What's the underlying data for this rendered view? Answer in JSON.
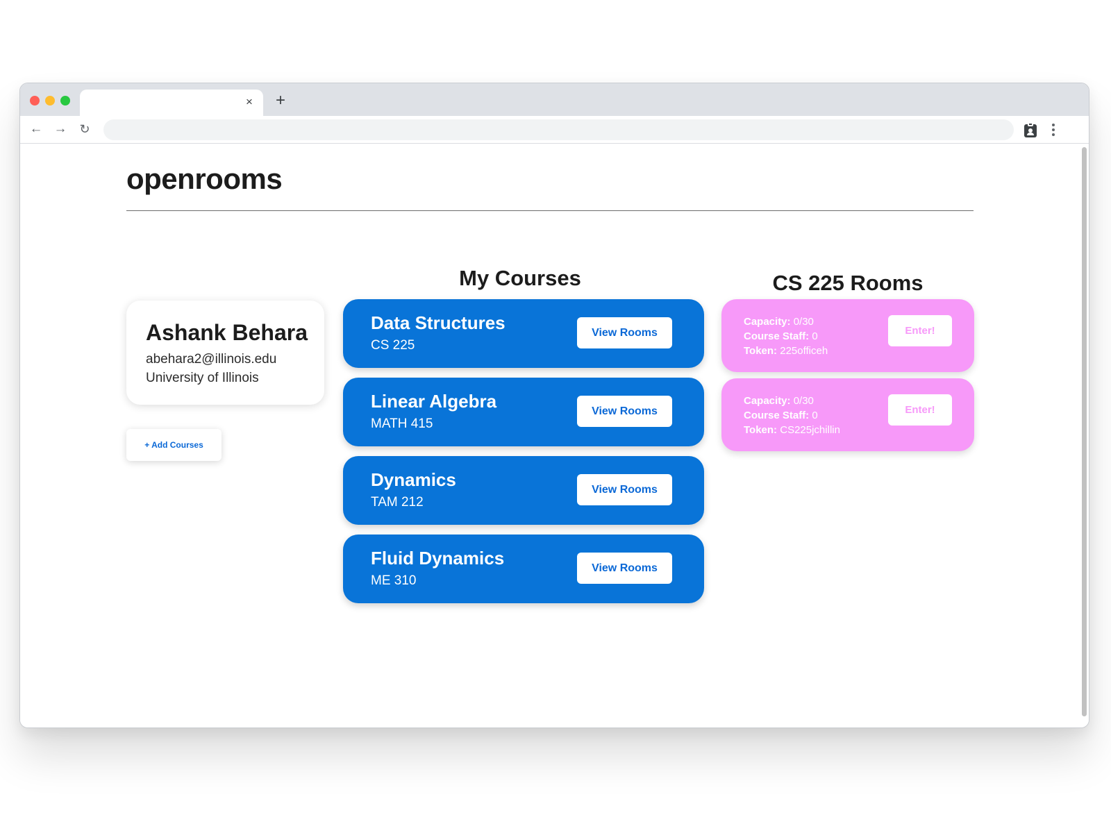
{
  "browser": {
    "tab_close": "×",
    "new_tab": "+",
    "back": "←",
    "forward": "→",
    "reload": "↻",
    "address_value": ""
  },
  "app": {
    "title": "openrooms"
  },
  "profile": {
    "name": "Ashank Behara",
    "email": "abehara2@illinois.edu",
    "university": "University of Illinois"
  },
  "add_courses_label": "+ Add Courses",
  "courses": {
    "heading": "My Courses",
    "items": [
      {
        "name": "Data Structures",
        "code": "CS 225",
        "button": "View Rooms"
      },
      {
        "name": "Linear Algebra",
        "code": "MATH 415",
        "button": "View Rooms"
      },
      {
        "name": "Dynamics",
        "code": "TAM 212",
        "button": "View Rooms"
      },
      {
        "name": "Fluid Dynamics",
        "code": "ME 310",
        "button": "View Rooms"
      }
    ]
  },
  "rooms": {
    "heading": "CS 225 Rooms",
    "capacity_label": "Capacity:",
    "staff_label": "Course Staff:",
    "token_label": "Token:",
    "items": [
      {
        "capacity": "0/30",
        "staff": "0",
        "token": "225officeh",
        "button": "Enter!"
      },
      {
        "capacity": "0/30",
        "staff": "0",
        "token": "CS225jchillin",
        "button": "Enter!"
      }
    ]
  },
  "colors": {
    "course_blue": "#0974d8",
    "room_pink": "#f799f9",
    "link_blue": "#0a68d6"
  }
}
